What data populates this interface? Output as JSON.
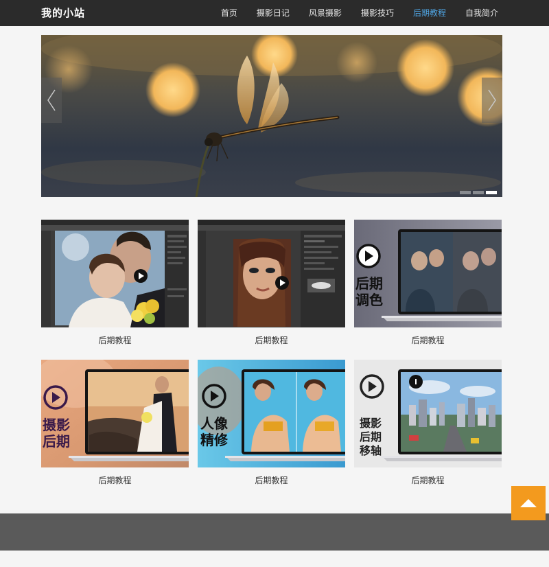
{
  "site": {
    "brand": "我的小站"
  },
  "nav": {
    "items": [
      {
        "label": "首页"
      },
      {
        "label": "摄影日记"
      },
      {
        "label": "风景摄影"
      },
      {
        "label": "摄影技巧"
      },
      {
        "label": "后期教程",
        "active": true
      },
      {
        "label": "自我简介"
      }
    ],
    "active_color": "#4fa3e0"
  },
  "banner": {
    "image": "dragonfly-bokeh-photo",
    "slide_count": 3,
    "active_slide": 3,
    "prev_icon": "chevron-left-icon",
    "next_icon": "chevron-right-icon"
  },
  "gallery": {
    "items": [
      {
        "caption": "后期教程",
        "image": "photoshop-wedding-couple"
      },
      {
        "caption": "后期教程",
        "image": "photoshop-portrait-woman"
      },
      {
        "caption": "后期教程",
        "image": "laptop-color-grading",
        "overlay": "后期\n调色"
      },
      {
        "caption": "后期教程",
        "image": "laptop-sunset-couple",
        "overlay": "摄影\n后期"
      },
      {
        "caption": "后期教程",
        "image": "laptop-portrait-retouch",
        "overlay": "人像\n精修"
      },
      {
        "caption": "后期教程",
        "image": "laptop-tilt-shift-city",
        "overlay": "摄影\n后期\n移轴"
      }
    ]
  },
  "back_to_top": {
    "icon": "arrow-up-icon",
    "color": "#f39a1e"
  },
  "colors": {
    "navbar": "#2b2b2b",
    "footer": "#5a5a5a",
    "page_bg": "#f5f5f5"
  }
}
